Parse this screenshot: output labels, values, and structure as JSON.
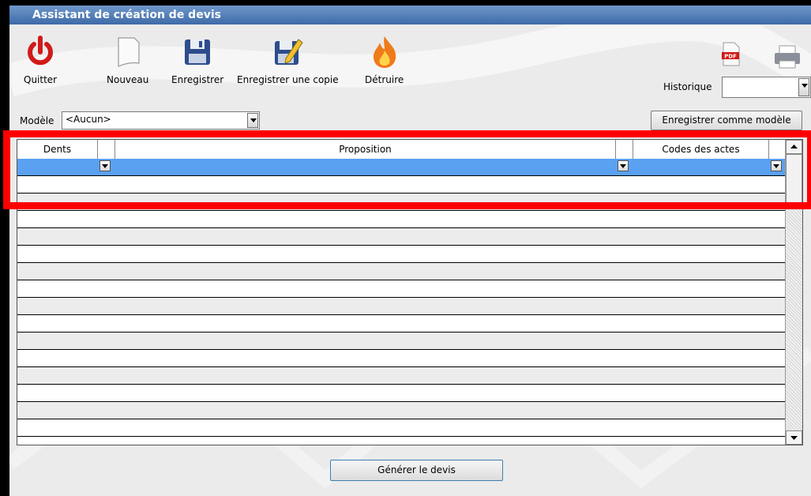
{
  "window": {
    "title": "Assistant de création de devis"
  },
  "toolbar": {
    "quit": "Quitter",
    "new": "Nouveau",
    "save": "Enregistrer",
    "save_copy": "Enregistrer une copie",
    "destroy": "Détruire",
    "pdf_badge": "PDF",
    "history_label": "Historique",
    "history_value": ""
  },
  "model": {
    "label": "Modèle",
    "value": "<Aucun>",
    "save_as_model": "Enregistrer comme modèle"
  },
  "grid": {
    "columns": [
      "Dents",
      "Proposition",
      "Codes des actes"
    ],
    "rows": [
      {
        "dents": "",
        "proposition": "",
        "codes": ""
      }
    ]
  },
  "footer": {
    "generate": "Générer le devis"
  },
  "colors": {
    "selected_row": "#5aa1f2",
    "highlight": "#ff0000",
    "titlebar": "#3e6aa8"
  }
}
